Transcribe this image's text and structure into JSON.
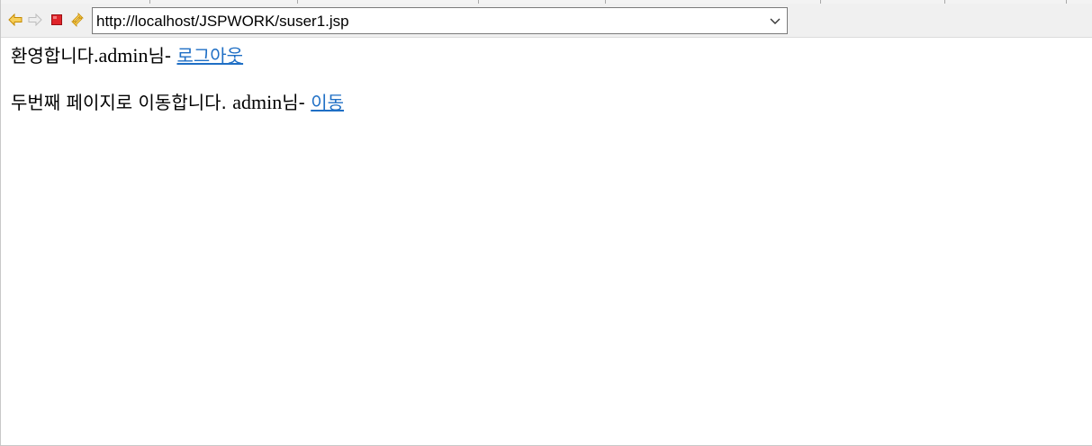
{
  "browser": {
    "url": "http://localhost/JSPWORK/suser1.jsp",
    "buttons": {
      "back_icon": "back-arrow-icon",
      "forward_icon": "forward-arrow-icon",
      "stop_icon": "stop-icon",
      "refresh_icon": "refresh-icon",
      "dropdown_icon": "chevron-down-icon"
    },
    "colors": {
      "back_arrow": "#e8a317",
      "forward_arrow": "#c9c9c9",
      "stop": "#e0242a",
      "refresh": "#e8a317"
    }
  },
  "content": {
    "line1": {
      "prefix_ko": "환영합니다",
      "user_text": ".admin",
      "suffix_ko": "님- ",
      "link_text": "로그아웃"
    },
    "line2": {
      "prefix_ko": "두번째 페이지로 이동합니다. ",
      "user_text": "admin",
      "suffix_ko": "님- ",
      "link_text": "이동"
    },
    "link_color": "#1f6fc5"
  }
}
